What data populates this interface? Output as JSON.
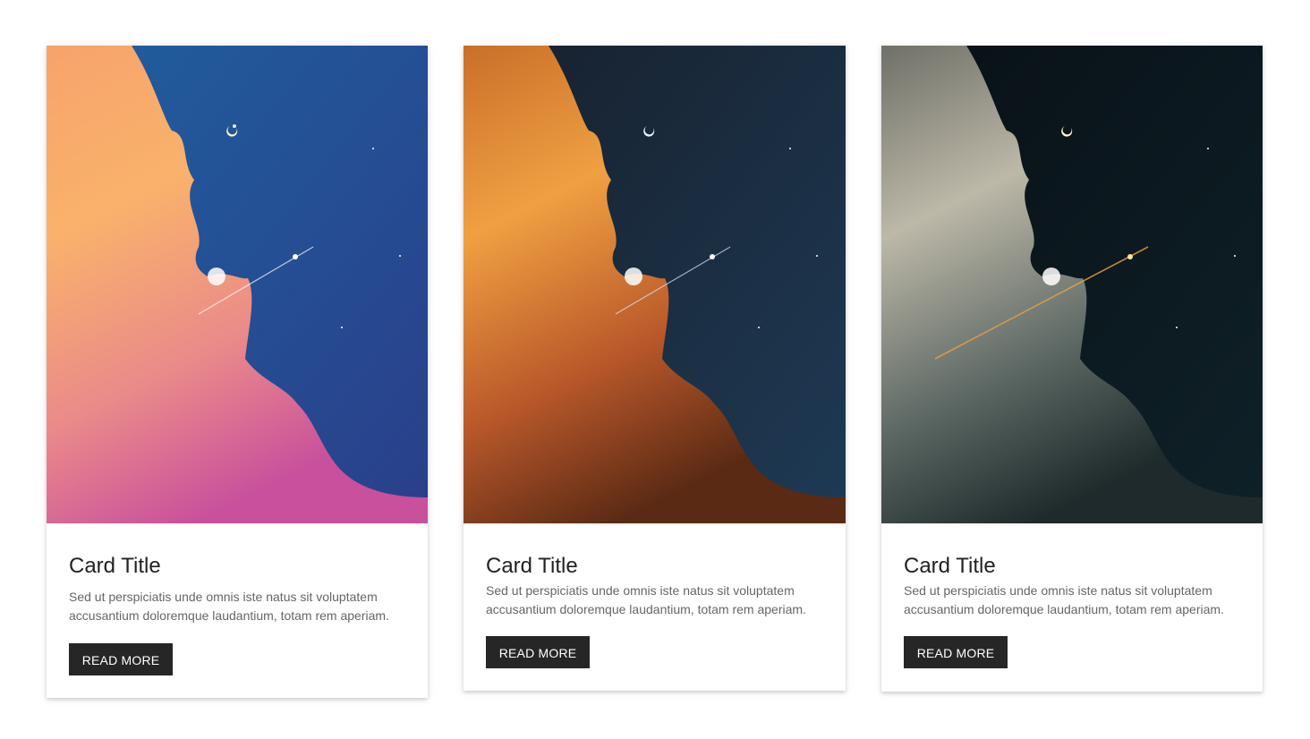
{
  "cards": [
    {
      "title": "Card Title",
      "text": "Sed ut perspiciatis unde omnis iste natus sit voluptatem accusantium doloremque laudantium, totam rem aperiam.",
      "button_label": "READ MORE",
      "image_icon": "sky-clouds-plane-image",
      "palette": {
        "sky_top": "#1f5f9e",
        "sky_bottom": "#2a3f8a",
        "cloud_light": "#f9b26b",
        "cloud_dark": "#d0539a"
      }
    },
    {
      "title": "Card Title",
      "text": "Sed ut perspiciatis unde omnis iste natus sit voluptatem accusantium doloremque laudantium, totam rem aperiam.",
      "button_label": "READ MORE",
      "image_icon": "sky-clouds-plane-image",
      "palette": {
        "sky_top": "#17202c",
        "sky_bottom": "#1e3a55",
        "cloud_light": "#f0a042",
        "cloud_dark": "#7a3a1a"
      }
    },
    {
      "title": "Card Title",
      "text": "Sed ut perspiciatis unde omnis iste natus sit voluptatem accusantium doloremque laudantium, totam rem aperiam.",
      "button_label": "READ MORE",
      "image_icon": "sky-clouds-plane-image",
      "palette": {
        "sky_top": "#081016",
        "sky_bottom": "#0f2128",
        "cloud_light": "#d8d4c6",
        "cloud_dark": "#2c3a3a"
      }
    }
  ],
  "colors": {
    "button_bg": "#262626",
    "title": "#222222",
    "body_text": "#666666"
  }
}
